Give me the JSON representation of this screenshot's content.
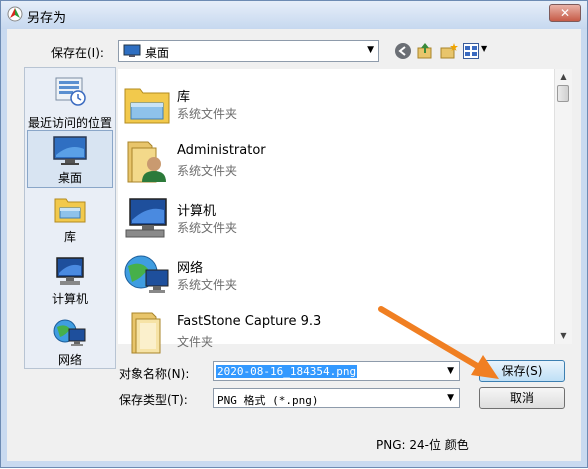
{
  "window": {
    "title": "另存为",
    "close_glyph": "✕"
  },
  "toolbar": {
    "save_in_label": "保存在(I):",
    "location": "桌面",
    "icons": [
      "back-icon",
      "up-folder-icon",
      "new-folder-icon",
      "view-menu-icon"
    ]
  },
  "places": [
    {
      "label": "最近访问的位置",
      "icon": "recent-places-icon"
    },
    {
      "label": "桌面",
      "icon": "desktop-icon",
      "selected": true
    },
    {
      "label": "库",
      "icon": "library-icon"
    },
    {
      "label": "计算机",
      "icon": "computer-icon"
    },
    {
      "label": "网络",
      "icon": "network-icon"
    }
  ],
  "files": [
    {
      "name": "库",
      "type": "系统文件夹",
      "icon": "library-folder-icon"
    },
    {
      "name": "Administrator",
      "type": "系统文件夹",
      "icon": "user-folder-icon"
    },
    {
      "name": "计算机",
      "type": "系统文件夹",
      "icon": "computer-icon"
    },
    {
      "name": "网络",
      "type": "系统文件夹",
      "icon": "network-icon"
    },
    {
      "name": "FastStone Capture 9.3",
      "type": "文件夹",
      "icon": "folder-icon"
    }
  ],
  "form": {
    "filename_label": "对象名称(N):",
    "filename_value": "2020-08-16_184354.png",
    "filetype_label": "保存类型(T):",
    "filetype_value": "PNG 格式 (*.png)"
  },
  "buttons": {
    "save": "保存(S)",
    "cancel": "取消"
  },
  "status": "PNG: 24-位 颜色",
  "colors": {
    "arrow": "#f07f22",
    "selection": "#3399ff"
  }
}
